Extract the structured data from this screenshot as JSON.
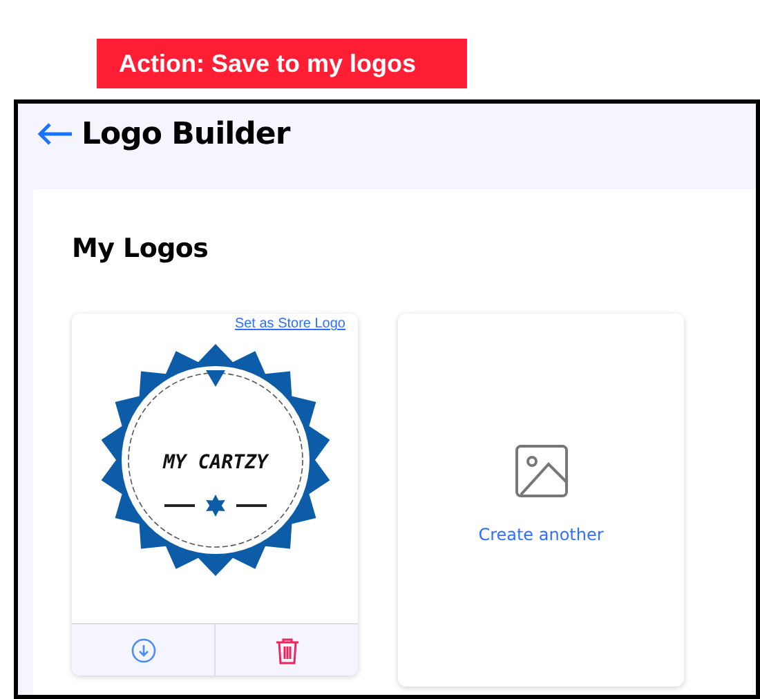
{
  "action_banner": "Action: Save to my logos",
  "header": {
    "title": "Logo Builder"
  },
  "section": {
    "title": "My Logos"
  },
  "logos": [
    {
      "kind": "logo",
      "link": "Set as Store Logo",
      "logo_text": "MY CARTZY"
    },
    {
      "kind": "create",
      "label": "Create another"
    }
  ]
}
